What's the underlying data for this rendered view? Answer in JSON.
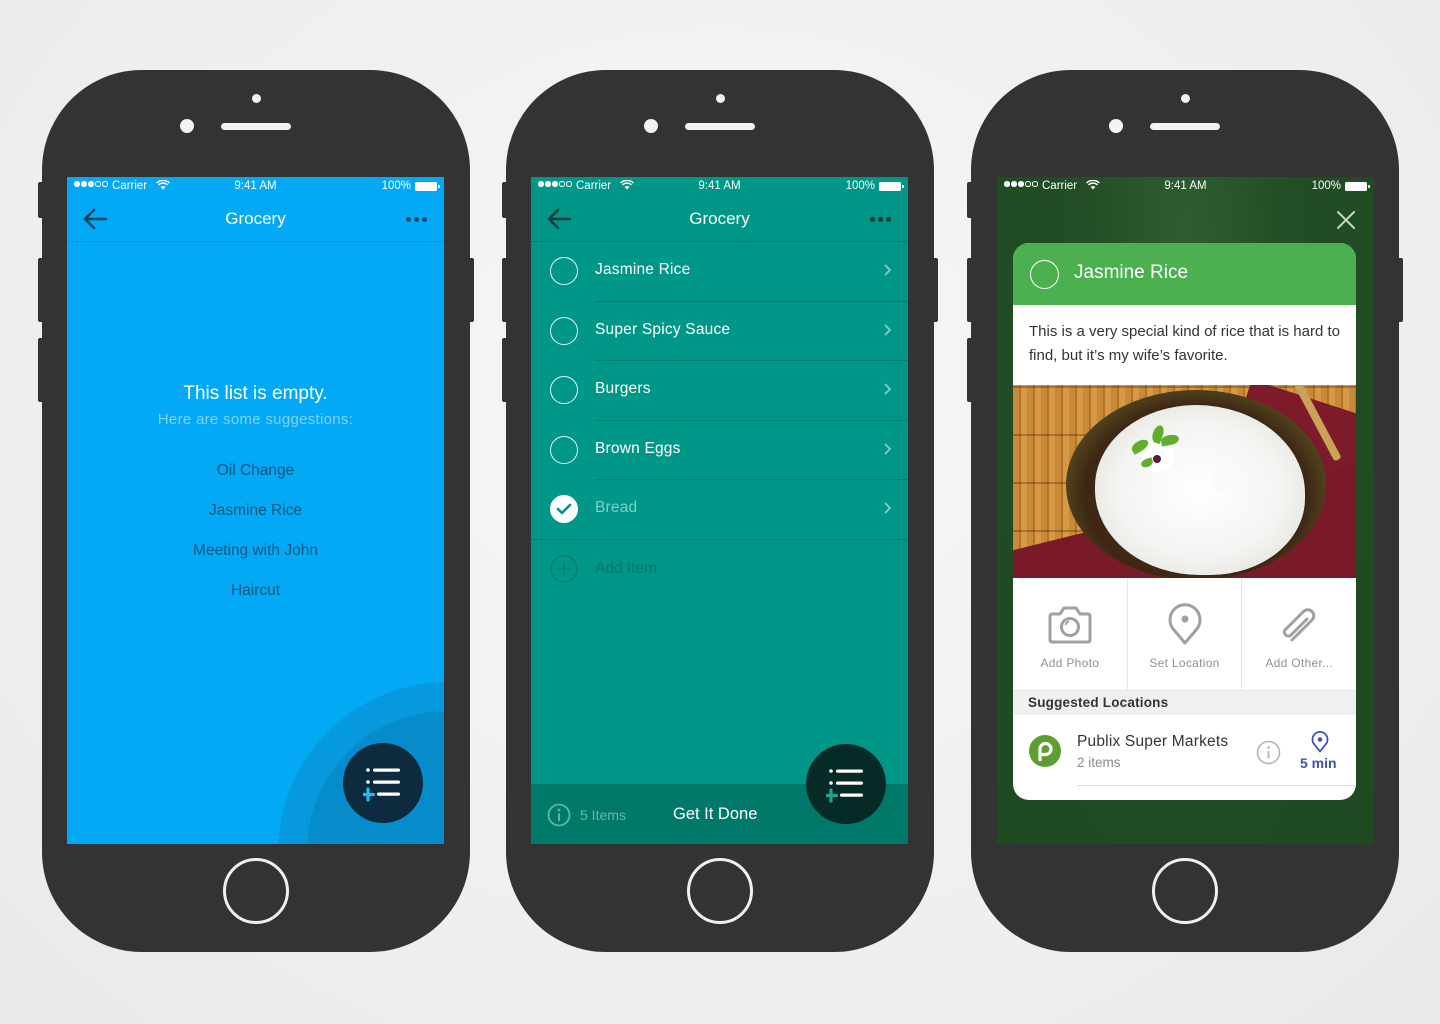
{
  "status_bar": {
    "carrier": "Carrier",
    "time": "9:41 AM",
    "battery": "100%"
  },
  "screens": [
    {
      "name": "empty-list",
      "title": "Grocery",
      "accent": "#03a9f4",
      "empty_title": "This list is empty.",
      "empty_subtitle": "Here are some suggestions:",
      "suggestions": [
        "Oil Change",
        "Jasmine Rice",
        "Meeting with John",
        "Haircut"
      ],
      "fab_icon": "add-to-list-icon"
    },
    {
      "name": "list",
      "title": "Grocery",
      "accent": "#009688",
      "items": [
        {
          "label": "Jasmine Rice",
          "done": false
        },
        {
          "label": "Super Spicy Sauce",
          "done": false
        },
        {
          "label": "Burgers",
          "done": false
        },
        {
          "label": "Brown Eggs",
          "done": false
        },
        {
          "label": "Bread",
          "done": true
        }
      ],
      "add_item_label": "Add Item",
      "footer": {
        "count": "5 Items",
        "action": "Get It Done"
      },
      "fab_icon": "add-to-list-icon"
    },
    {
      "name": "item-detail",
      "accent": "#4caf50",
      "item_title": "Jasmine Rice",
      "note": "This is a very special kind of rice that is hard to find, but it’s my wife’s favorite.",
      "photo_alt": "Bowl of jasmine rice with basil garnish",
      "actions": [
        {
          "label": "Add Photo",
          "icon": "camera-icon"
        },
        {
          "label": "Set Location",
          "icon": "location-pin-icon"
        },
        {
          "label": "Add Other...",
          "icon": "paperclip-icon"
        }
      ],
      "suggested_header": "Suggested Locations",
      "locations": [
        {
          "name": "Publix Super Markets",
          "items": "2 items",
          "eta": "5 min",
          "logo_letter": "p"
        }
      ],
      "eta_color": "#3f51b5"
    }
  ]
}
